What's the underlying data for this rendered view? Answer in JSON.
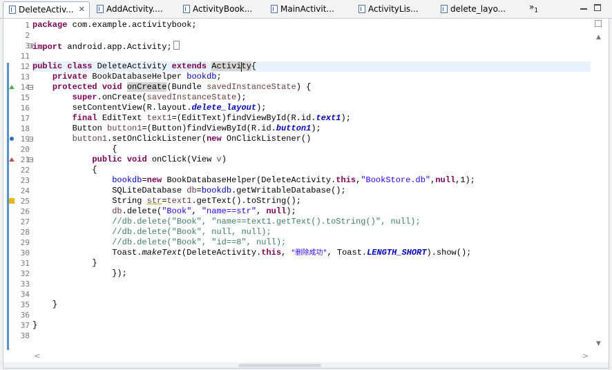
{
  "tabs": [
    {
      "label": "DeleteActiv...",
      "active": true,
      "close": "✕",
      "icon": "java-file-icon"
    },
    {
      "label": "AddActivity....",
      "active": false,
      "icon": "java-file-icon"
    },
    {
      "label": "ActivityBook...",
      "active": false,
      "icon": "manifest-file-icon"
    },
    {
      "label": "MainActivit...",
      "active": false,
      "icon": "java-file-icon"
    },
    {
      "label": "ActivityLis...",
      "active": false,
      "icon": "java-file-icon"
    },
    {
      "label": "delete_layo...",
      "active": false,
      "icon": "layout-file-icon"
    }
  ],
  "tab_overflow": {
    "symbol": "»",
    "count": "1"
  },
  "line_numbers": [
    "1",
    "2",
    "3",
    "11",
    "12",
    "13",
    "14",
    "15",
    "16",
    "17",
    "18",
    "19",
    "20",
    "21",
    "22",
    "23",
    "24",
    "25",
    "26",
    "27",
    "28",
    "29",
    "30",
    "31",
    "32",
    "33",
    "34",
    "35",
    "36",
    "37",
    "38"
  ],
  "code": {
    "l1_kw": "package",
    "l1_rest": " com.example.activitybook;",
    "l3_kw": "import",
    "l3_rest": " android.app.Activity;",
    "l12_kw1": "public",
    "l12_kw2": "class",
    "l12_name": " DeleteActivity ",
    "l12_kw3": "extends",
    "l12_sup1": "Activit",
    "l12_sup2": "y",
    "l12_brace": "{",
    "l13_kw": "private",
    "l13_type": " BookDatabaseHelper ",
    "l13_field": "bookdb",
    "l13_end": ";",
    "l14_kw1": "protected",
    "l14_kw2": "void",
    "l14_m": "onCreate",
    "l14_rest": "(Bundle ",
    "l14_p": "savedInstanceState",
    "l14_end": ") {",
    "l15_kw": "super",
    "l15_mid": ".onCreate(",
    "l15_p": "savedInstanceState",
    "l15_end": ");",
    "l16_a": "setContentView(R.layout.",
    "l16_sf": "delete_layout",
    "l16_end": ");",
    "l17_kw": "final",
    "l17_a": " EditText ",
    "l17_v": "text1",
    "l17_b": "=(EditText)findViewById(R.id.",
    "l17_sf": "text1",
    "l17_end": ");",
    "l18_a": "Button ",
    "l18_v": "button1",
    "l18_b": "=(Button)findViewById(R.id.",
    "l18_sf": "button1",
    "l18_end": ");",
    "l19_v": "button1",
    "l19_a": ".setOnClickListener(",
    "l19_kw": "new",
    "l19_end": " OnClickListener()",
    "l20": "{",
    "l21_kw1": "public",
    "l21_kw2": "void",
    "l21_a": " onClick(View ",
    "l21_v": "v",
    "l21_end": ")",
    "l22": "{",
    "l23_f": "bookdb",
    "l23_a": "=",
    "l23_kw": "new",
    "l23_b": " BookDatabaseHelper(DeleteActivity.",
    "l23_kw2": "this",
    "l23_c": ",",
    "l23_str": "\"BookStore.db\"",
    "l23_d": ",",
    "l23_kw3": "null",
    "l23_end": ",1);",
    "l24_a": "SQLiteDatabase ",
    "l24_v": "db",
    "l24_b": "=",
    "l24_f": "bookdb",
    "l24_end": ".getWritableDatabase();",
    "l25_a": "String ",
    "l25_v": "str",
    "l25_b": "=",
    "l25_v2": "text1",
    "l25_end": ".getText().toString();",
    "l26_v": "db",
    "l26_a": ".delete(",
    "l26_s1": "\"Book\"",
    "l26_b": ", ",
    "l26_s2": "\"name==str\"",
    "l26_c": ", ",
    "l26_kw": "null",
    "l26_end": ");",
    "l27": "//db.delete(\"Book\", \"name==text1.getText().toString()\", null);",
    "l28": "//db.delete(\"Book\", null, null);",
    "l29": "//db.delete(\"Book\", \"id==8\", null);",
    "l30_a": "Toast.",
    "l30_st": "makeText",
    "l30_b": "(DeleteActivity.",
    "l30_kw": "this",
    "l30_c": ", ",
    "l30_str": "\"删除成功\"",
    "l30_d": ", Toast.",
    "l30_sf": "LENGTH_SHORT",
    "l30_end": ").show();",
    "l31": "}",
    "l32": "});",
    "l35": "}",
    "l37": "}"
  }
}
